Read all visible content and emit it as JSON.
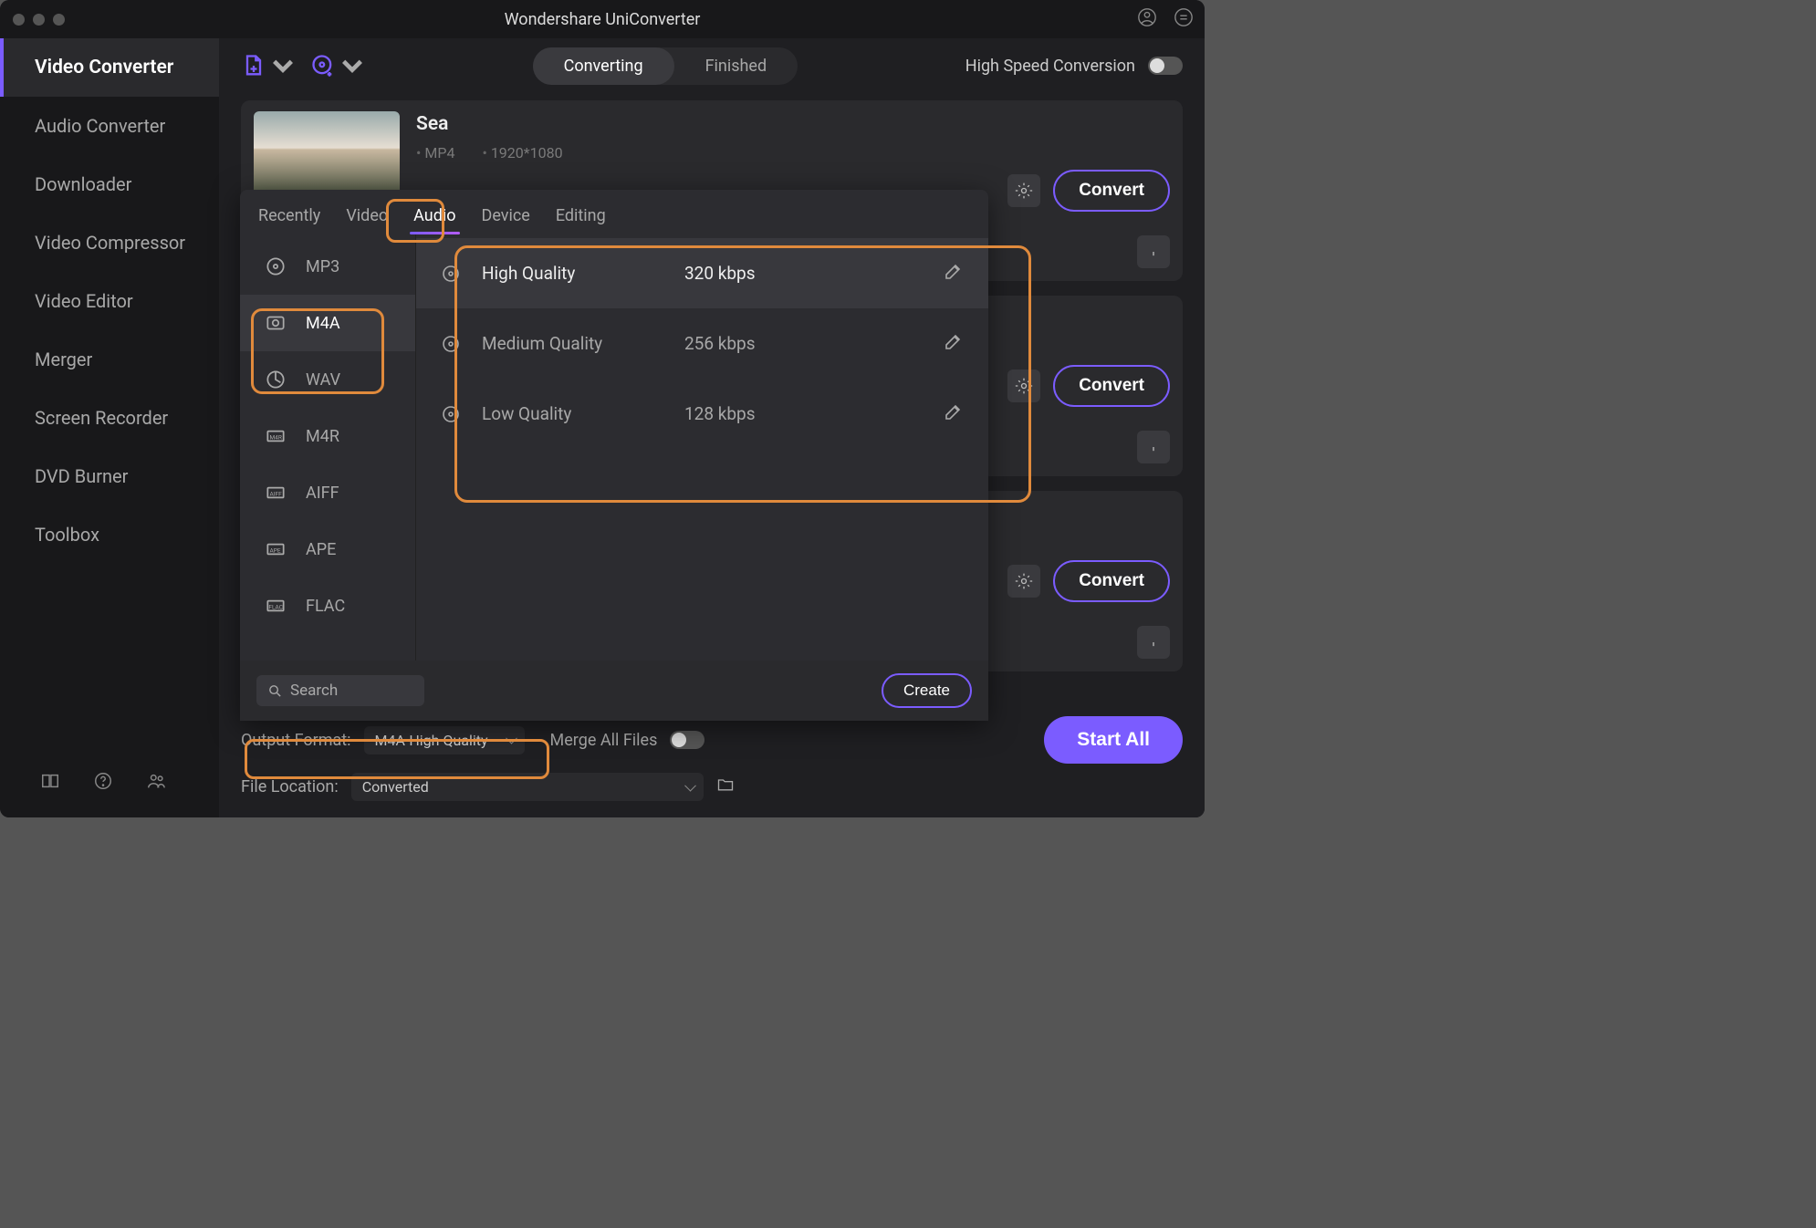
{
  "titlebar": {
    "title": "Wondershare UniConverter"
  },
  "sidebar": {
    "items": [
      {
        "label": "Video Converter",
        "active": true
      },
      {
        "label": "Audio Converter"
      },
      {
        "label": "Downloader"
      },
      {
        "label": "Video Compressor"
      },
      {
        "label": "Video Editor"
      },
      {
        "label": "Merger"
      },
      {
        "label": "Screen Recorder"
      },
      {
        "label": "DVD Burner"
      },
      {
        "label": "Toolbox"
      }
    ]
  },
  "toolbar": {
    "tabs": [
      {
        "label": "Converting",
        "active": true
      },
      {
        "label": "Finished"
      }
    ],
    "hsc_label": "High Speed Conversion"
  },
  "files": [
    {
      "name": "Sea",
      "format": "MP4",
      "res": "1920*1080",
      "convert": "Convert"
    },
    {
      "name": "",
      "format": "",
      "res": "",
      "convert": "Convert"
    },
    {
      "name": "",
      "format": "",
      "res": "",
      "convert": "Convert"
    }
  ],
  "popup": {
    "tabs": [
      {
        "label": "Recently"
      },
      {
        "label": "Video"
      },
      {
        "label": "Audio",
        "active": true
      },
      {
        "label": "Device"
      },
      {
        "label": "Editing"
      }
    ],
    "formats": [
      {
        "label": "MP3"
      },
      {
        "label": "M4A",
        "active": true
      },
      {
        "label": "WAV"
      },
      {
        "label": "M4R"
      },
      {
        "label": "AIFF"
      },
      {
        "label": "APE"
      },
      {
        "label": "FLAC"
      }
    ],
    "qualities": [
      {
        "name": "High Quality",
        "rate": "320 kbps",
        "active": true
      },
      {
        "name": "Medium Quality",
        "rate": "256 kbps"
      },
      {
        "name": "Low Quality",
        "rate": "128 kbps"
      }
    ],
    "search_placeholder": "Search",
    "create_label": "Create"
  },
  "bottom": {
    "output_label": "Output Format:",
    "output_value": "M4A-High Quality",
    "merge_label": "Merge All Files",
    "location_label": "File Location:",
    "location_value": "Converted",
    "startall": "Start All"
  }
}
